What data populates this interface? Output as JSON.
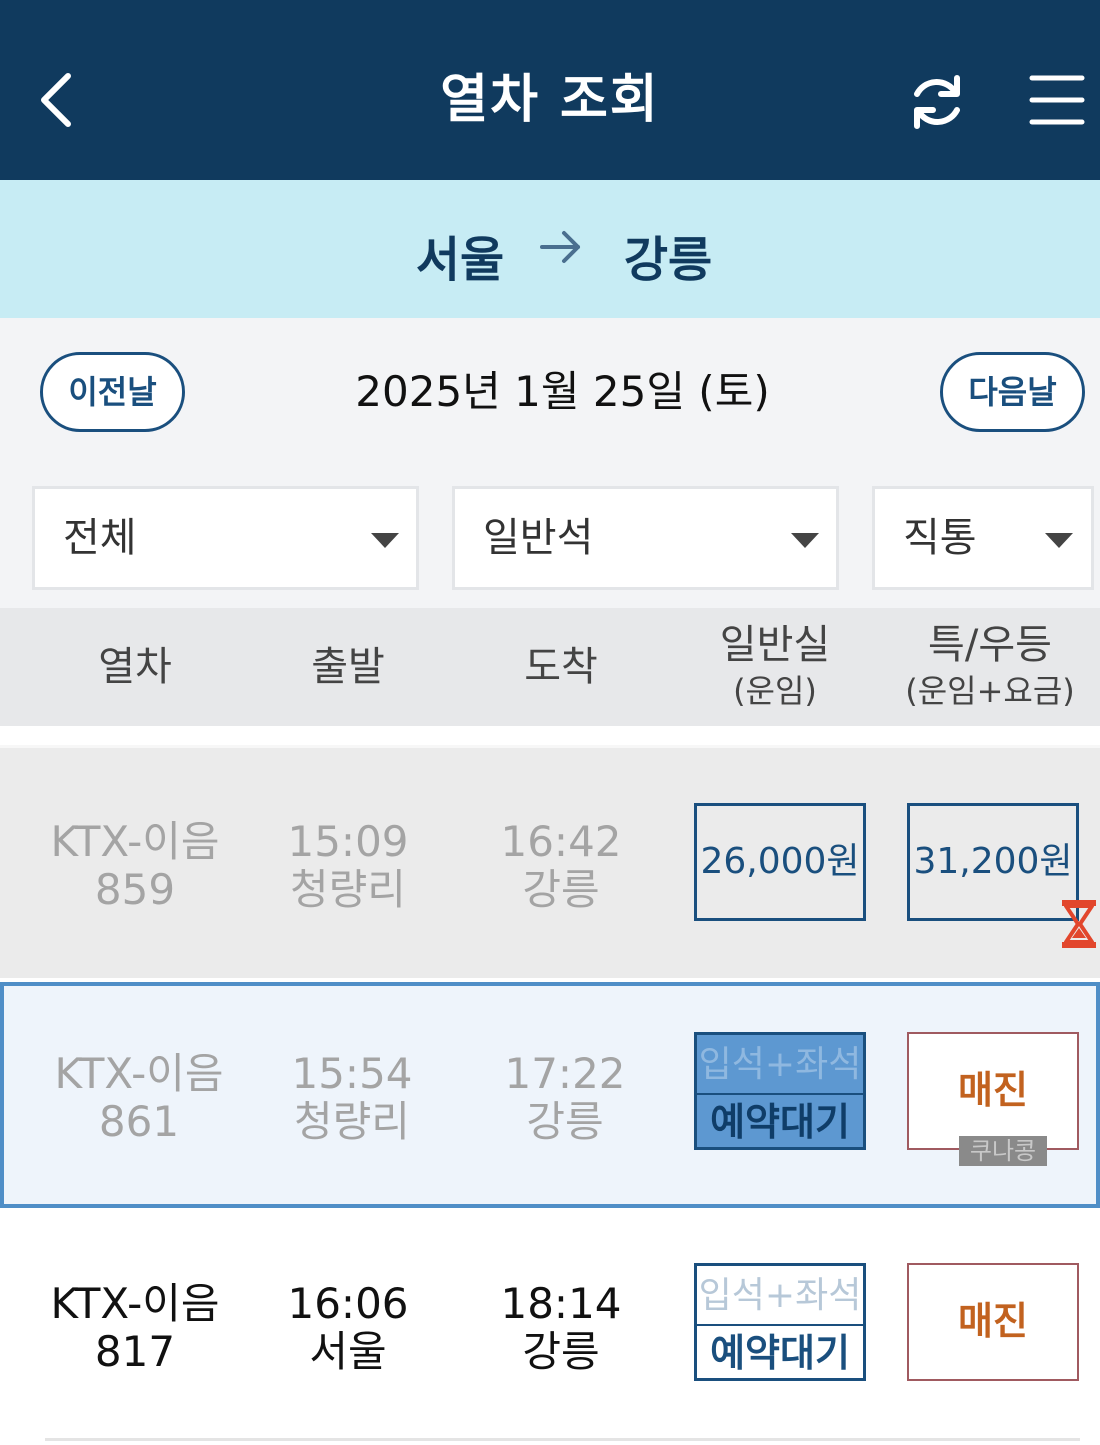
{
  "header": {
    "title": "열차 조회",
    "back_icon": "chevron-left-icon",
    "refresh_icon": "refresh-icon",
    "menu_icon": "hamburger-menu-icon"
  },
  "route": {
    "from": "서울",
    "to": "강릉"
  },
  "date_nav": {
    "prev_label": "이전날",
    "date": "2025년 1월 25일 (토)",
    "next_label": "다음날"
  },
  "filters": {
    "train_type": "전체",
    "seat_class": "일반석",
    "route_type": "직통"
  },
  "columns": {
    "train": "열차",
    "departure": "출발",
    "arrival": "도착",
    "standard": "일반실",
    "standard_sub": "(운임)",
    "first": "특/우등",
    "first_sub": "(운임+요금)"
  },
  "trains": [
    {
      "name": "KTX-이음",
      "number": "859",
      "dep_time": "15:09",
      "dep_station": "청량리",
      "arr_time": "16:42",
      "arr_station": "강릉",
      "standard_price": "26,000원",
      "first_price": "31,200원"
    },
    {
      "name": "KTX-이음",
      "number": "861",
      "dep_time": "15:54",
      "dep_station": "청량리",
      "arr_time": "17:22",
      "arr_station": "강릉",
      "standard_top": "입석+좌석",
      "standard_bottom": "예약대기",
      "first_status": "매진",
      "coupon": "쿠나콩"
    },
    {
      "name": "KTX-이음",
      "number": "817",
      "dep_time": "16:06",
      "dep_station": "서울",
      "arr_time": "18:14",
      "arr_station": "강릉",
      "standard_top": "입석+좌석",
      "standard_bottom": "예약대기",
      "first_status": "매진"
    }
  ],
  "colors": {
    "header_bg": "#103a5e",
    "route_bg": "#c7ecf4",
    "accent": "#1a4f7e",
    "sold_out_text": "#c2621f",
    "selected_row_border": "#4f8ec7"
  }
}
